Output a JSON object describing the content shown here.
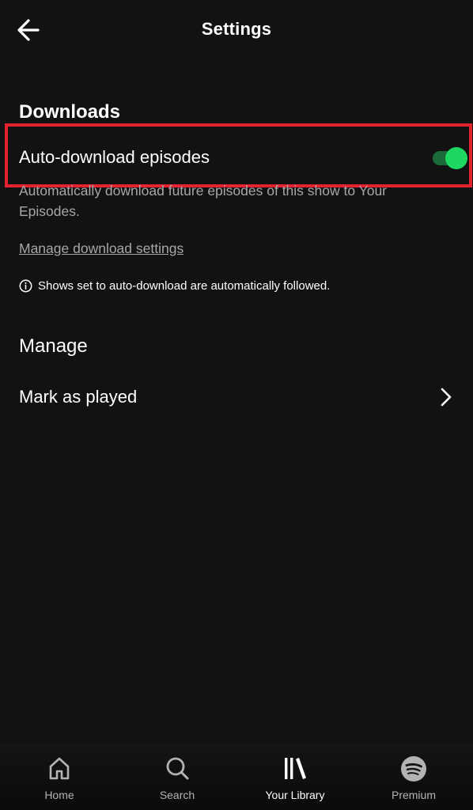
{
  "header": {
    "title": "Settings",
    "back_icon": "arrow-left-icon"
  },
  "downloads": {
    "section_title": "Downloads",
    "auto_download_label": "Auto-download episodes",
    "auto_download_enabled": true,
    "description": "Automatically download future episodes of this show to Your Episodes.",
    "manage_link": "Manage download settings",
    "info_text": "Shows set to auto-download are automatically followed."
  },
  "manage": {
    "section_title": "Manage",
    "items": [
      {
        "label": "Mark as played"
      }
    ]
  },
  "bottom_nav": {
    "items": [
      {
        "label": "Home",
        "icon": "home-icon"
      },
      {
        "label": "Search",
        "icon": "search-icon"
      },
      {
        "label": "Your Library",
        "icon": "library-icon",
        "active": true
      },
      {
        "label": "Premium",
        "icon": "spotify-icon"
      }
    ]
  },
  "colors": {
    "background": "#121212",
    "accent": "#1ed760",
    "highlight_border": "#e5222f",
    "muted_text": "#a7a7a7"
  }
}
